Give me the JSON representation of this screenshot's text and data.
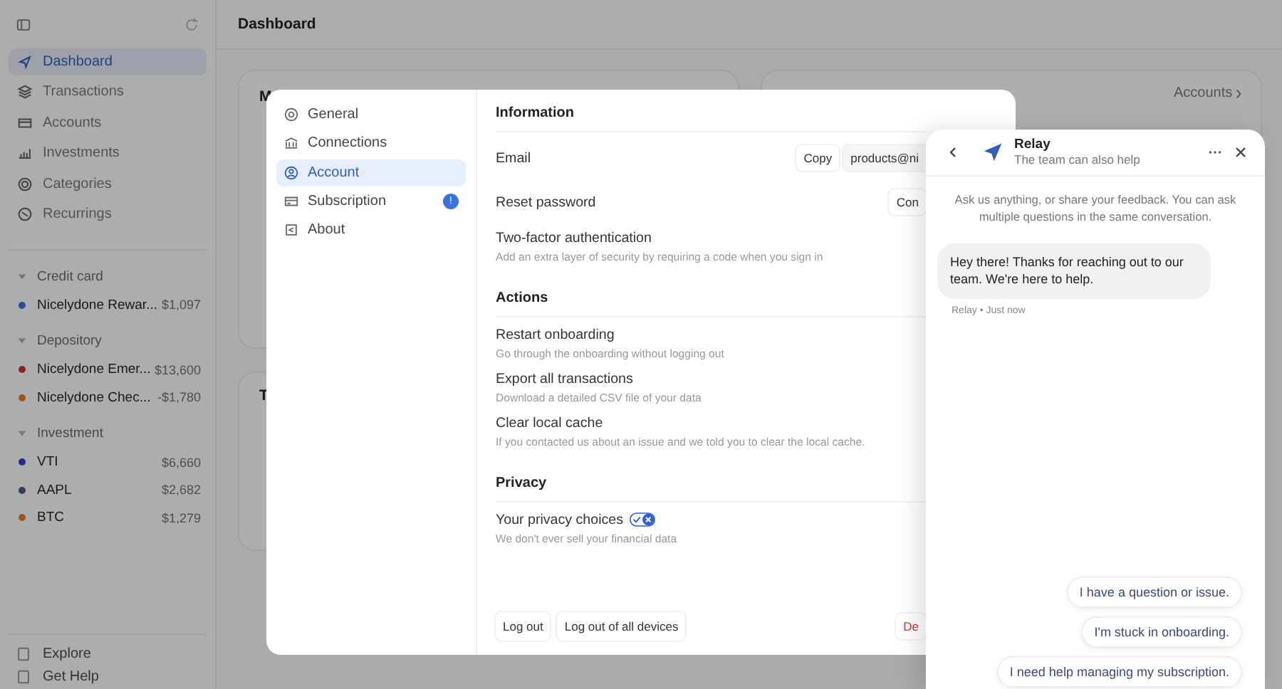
{
  "sidebar": {
    "nav": [
      {
        "label": "Dashboard",
        "selected": true
      },
      {
        "label": "Transactions",
        "selected": false
      },
      {
        "label": "Accounts",
        "selected": false
      },
      {
        "label": "Investments",
        "selected": false
      },
      {
        "label": "Categories",
        "selected": false
      },
      {
        "label": "Recurrings",
        "selected": false
      }
    ],
    "groups": [
      {
        "label": "Credit card",
        "expanded": true,
        "accounts": [
          {
            "name": "Nicelydone Rewar...",
            "amount": "$1,097",
            "color": "#2a4e96"
          }
        ]
      },
      {
        "label": "Depository",
        "expanded": true,
        "accounts": [
          {
            "name": "Nicelydone Emer...",
            "amount": "$13,600",
            "color": "#86281e"
          },
          {
            "name": "Nicelydone Chec...",
            "amount": "-$1,780",
            "color": "#9c561d"
          }
        ]
      },
      {
        "label": "Investment",
        "expanded": true,
        "accounts": [
          {
            "name": "VTI",
            "amount": "$6,660",
            "color": "#282896"
          },
          {
            "name": "AAPL",
            "amount": "$2,682",
            "color": "#343f55"
          },
          {
            "name": "BTC",
            "amount": "$1,279",
            "color": "#9c561d"
          }
        ]
      }
    ],
    "footer": [
      "Explore",
      "Get Help"
    ]
  },
  "header": {
    "title": "Dashboard"
  },
  "cards": {
    "first_title": "M",
    "second_title": "T",
    "accounts_link": "Accounts"
  },
  "settings": {
    "nav": [
      {
        "label": "General",
        "selected": false
      },
      {
        "label": "Connections",
        "selected": false
      },
      {
        "label": "Account",
        "selected": true
      },
      {
        "label": "Subscription",
        "selected": false,
        "badge": "!"
      },
      {
        "label": "About",
        "selected": false
      }
    ],
    "sections": [
      {
        "title": "Information",
        "rows": [
          {
            "kind": "text",
            "label": "Email",
            "buttons": [
              "Copy",
              "products@ni"
            ]
          },
          {
            "kind": "text",
            "label": "Reset password",
            "buttons": [
              "Con"
            ]
          },
          {
            "kind": "text",
            "label": "Two-factor authentication",
            "description": "Add an extra layer of security by requiring a code when you sign in"
          }
        ]
      },
      {
        "title": "Actions",
        "rows": [
          {
            "kind": "text",
            "label": "Restart onboarding",
            "description": "Go through the onboarding without logging out"
          },
          {
            "kind": "text",
            "label": "Export all transactions",
            "description": "Download a detailed CSV file of your data"
          },
          {
            "kind": "text",
            "label": "Clear local cache",
            "description": "If you contacted us about an issue and we told you to clear the local cache."
          }
        ]
      },
      {
        "title": "Privacy",
        "rows": [
          {
            "kind": "privacy",
            "label": "Your privacy choices",
            "description": "We don't ever sell your financial data"
          }
        ]
      }
    ],
    "footer_buttons": [
      "Log out",
      "Log out of all devices"
    ],
    "danger_button": "De"
  },
  "chat": {
    "title": "Relay",
    "subtitle": "The team can also help",
    "intro": "Ask us anything, or share your feedback. You can ask multiple questions in the same conversation.",
    "message": "Hey there! Thanks for reaching out to our team. We're here to help.",
    "meta": "Relay • Just now",
    "quick_replies": [
      "I have a question or issue.",
      "I'm stuck in onboarding.",
      "I need help managing my subscription."
    ]
  }
}
